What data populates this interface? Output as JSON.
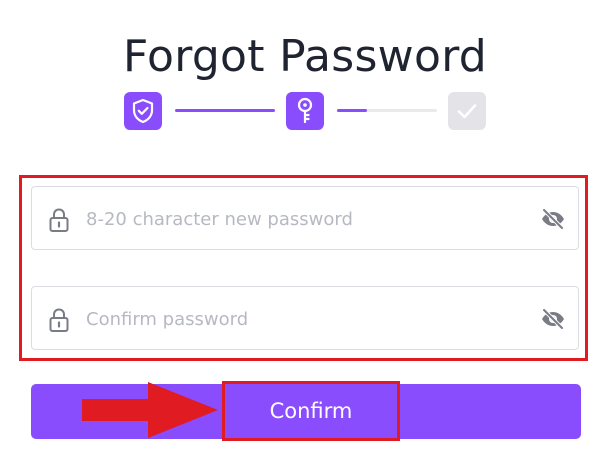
{
  "header": {
    "title": "Forgot Password"
  },
  "stepper": {
    "steps": [
      {
        "icon": "shield-check-icon",
        "state": "done"
      },
      {
        "icon": "key-icon",
        "state": "active"
      },
      {
        "icon": "check-icon",
        "state": "pending"
      }
    ],
    "progress_2_fraction": 0.3
  },
  "form": {
    "new_password": {
      "placeholder": "8-20 character new password",
      "value": "",
      "icon": "lock-icon",
      "toggle_icon": "eye-slash-icon"
    },
    "confirm_password": {
      "placeholder": "Confirm password",
      "value": "",
      "icon": "lock-icon",
      "toggle_icon": "eye-slash-icon"
    }
  },
  "actions": {
    "confirm_label": "Confirm"
  },
  "annotations": {
    "highlight_color": "#e11b22",
    "arrow_icon": "red-arrow-right"
  },
  "colors": {
    "accent": "#8a4dfd",
    "pending_step": "#e3e3e8",
    "track": "#e9e9ee",
    "title": "#1f2430",
    "placeholder": "#b7b9c2",
    "icon_gray": "#7a7c85"
  }
}
